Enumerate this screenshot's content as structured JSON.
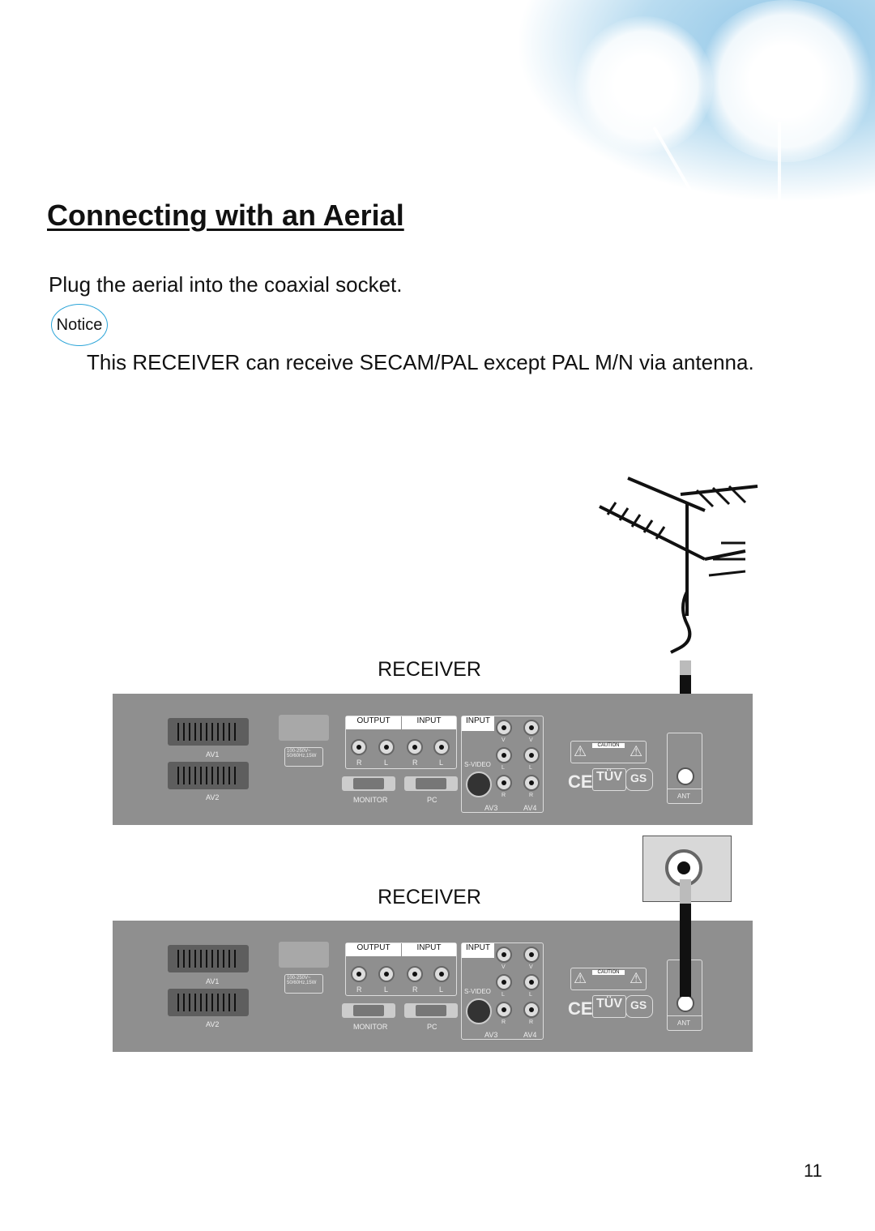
{
  "title": "Connecting with an Aerial",
  "intro": "Plug the aerial into the coaxial socket.",
  "notice": {
    "label": "Notice",
    "text": "This RECEIVER can receive SECAM/PAL except PAL M/N via antenna."
  },
  "diagram": {
    "receiver_label": "RECEIVER",
    "panel": {
      "av1": "AV1",
      "av2": "AV2",
      "power": "100-250V~ 50/60Hz,15W",
      "output": "OUTPUT",
      "input": "INPUT",
      "input2": "INPUT",
      "r": "R",
      "l": "L",
      "v": "V",
      "svideo": "S-VIDEO",
      "monitor": "MONITOR",
      "pc": "PC",
      "av3": "AV3",
      "av4": "AV4",
      "caution": "CAUTION",
      "ce": "CE",
      "tuv": "TÜV",
      "gs": "GS",
      "ant": "ANT"
    }
  },
  "page_number": "11",
  "colors": {
    "panel": "#8f8f8f",
    "sky": "#8ec4e6",
    "notice_border": "#2aa4d8"
  }
}
